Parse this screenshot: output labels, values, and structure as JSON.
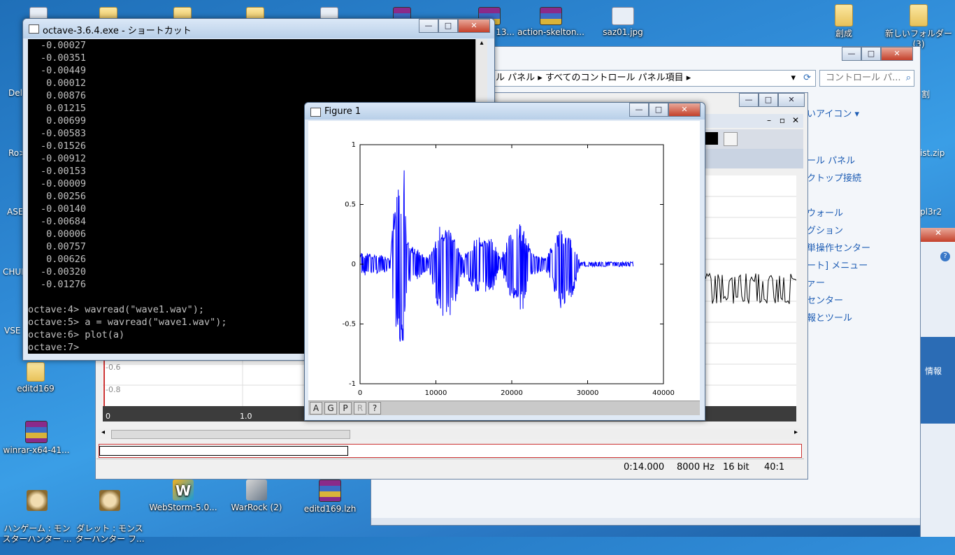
{
  "desktop": {
    "icons": [
      {
        "label": "13...",
        "type": "rar"
      },
      {
        "label": "action-skelton...",
        "type": "rar"
      },
      {
        "label": "saz01.jpg",
        "type": "jpg"
      },
      {
        "label": "創成",
        "type": "folder"
      },
      {
        "label": "新しいフォルダー",
        "type": "folder"
      },
      {
        "label": "editd169",
        "type": "folder"
      },
      {
        "label": "winrar-x64-41...",
        "type": "rar"
      },
      {
        "label": "ハンゲーム : モン\nスターハンター ...",
        "type": "skull"
      },
      {
        "label": "ダレット : モンス\nターハンター フ...",
        "type": "skull"
      },
      {
        "label": "WebStorm-5.0...",
        "type": "ws"
      },
      {
        "label": "WarRock (2)",
        "type": "wr"
      },
      {
        "label": "editd169.lzh",
        "type": "rar"
      }
    ],
    "edge_left": [
      "Del",
      "Ro>",
      "ASE",
      "CHUI",
      "VSE"
    ],
    "edge_right": [
      "割",
      "ist.zip",
      "pl3r2",
      "情報"
    ],
    "new_folder_suffix": "(3)"
  },
  "console": {
    "title": "octave-3.6.4.exe - ショートカット",
    "values": [
      "-0.00027",
      "-0.00351",
      "-0.00449",
      " 0.00012",
      " 0.00876",
      " 0.01215",
      " 0.00699",
      "-0.00583",
      "-0.01526",
      "-0.00912",
      "-0.00153",
      "-0.00009",
      " 0.00256",
      "-0.00140",
      "-0.00684",
      " 0.00006",
      " 0.00757",
      " 0.00626",
      "-0.00320",
      "-0.01276"
    ],
    "commands": [
      "octave:4> wavread(\"wave1.wav\");",
      "octave:5> a = wavread(\"wave1.wav\");",
      "octave:6> plot(a)",
      "octave:7>"
    ]
  },
  "figure": {
    "title": "Figure 1",
    "toolbar": [
      "A",
      "G",
      "P",
      "R",
      "?"
    ],
    "line_color": "#0000ff"
  },
  "chart_data": {
    "type": "line",
    "title": "",
    "xlabel": "",
    "ylabel": "",
    "xlim": [
      0,
      40000
    ],
    "ylim": [
      -1,
      1
    ],
    "xticks": [
      0,
      10000,
      20000,
      30000,
      40000
    ],
    "yticks": [
      -1,
      -0.5,
      0,
      0.5,
      1
    ],
    "xtick_labels": [
      "0",
      "10000",
      "20000",
      "30000",
      "40000"
    ],
    "ytick_labels": [
      "-1",
      "-0.5",
      "0",
      "0.5",
      "1"
    ],
    "grid": false,
    "n_samples": 36000,
    "envelope": [
      {
        "x": 0,
        "top": 0.1,
        "bottom": -0.1
      },
      {
        "x": 4000,
        "top": 0.06,
        "bottom": -0.06
      },
      {
        "x": 4500,
        "top": 0.5,
        "bottom": -0.5
      },
      {
        "x": 5800,
        "top": 0.82,
        "bottom": -0.75
      },
      {
        "x": 6200,
        "top": 0.2,
        "bottom": -0.2
      },
      {
        "x": 9000,
        "top": 0.05,
        "bottom": -0.05
      },
      {
        "x": 10500,
        "top": 0.32,
        "bottom": -0.42
      },
      {
        "x": 12000,
        "top": 0.3,
        "bottom": -0.5
      },
      {
        "x": 13500,
        "top": 0.05,
        "bottom": -0.1
      },
      {
        "x": 15500,
        "top": 0.25,
        "bottom": -0.25
      },
      {
        "x": 17500,
        "top": 0.22,
        "bottom": -0.22
      },
      {
        "x": 18500,
        "top": 0.05,
        "bottom": -0.05
      },
      {
        "x": 20000,
        "top": 0.3,
        "bottom": -0.3
      },
      {
        "x": 21500,
        "top": 0.36,
        "bottom": -0.42
      },
      {
        "x": 22500,
        "top": 0.1,
        "bottom": -0.1
      },
      {
        "x": 24500,
        "top": 0.05,
        "bottom": -0.05
      },
      {
        "x": 26500,
        "top": 0.32,
        "bottom": -0.38
      },
      {
        "x": 28000,
        "top": 0.2,
        "bottom": -0.3
      },
      {
        "x": 29000,
        "top": 0.02,
        "bottom": -0.02
      },
      {
        "x": 36000,
        "top": 0.02,
        "bottom": -0.02
      }
    ]
  },
  "explorer": {
    "address": [
      "ル パネル",
      "すべてのコントロール パネル項目"
    ],
    "search_placeholder": "コントロール パ...",
    "view_label": "いアイコン",
    "side_links": [
      "ール パネル",
      "クトップ接続",
      "ウォール",
      "グション",
      "単操作センター",
      "ート] メニュー",
      "ァー",
      "センター",
      "報とツール"
    ]
  },
  "audio_editor": {
    "y_labels": [
      "-0.6",
      "-0.8"
    ],
    "x_labels": [
      "0",
      "1.0"
    ],
    "status": {
      "time": "0:14.000",
      "rate": "8000 Hz",
      "bits": "16 bit",
      "zoom": "40:1"
    }
  }
}
